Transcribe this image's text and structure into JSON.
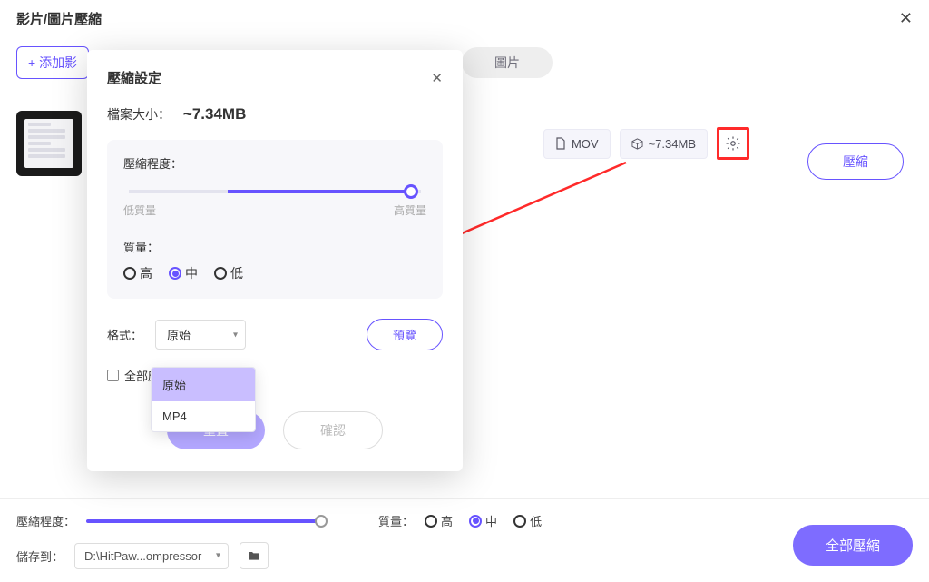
{
  "header": {
    "title": "影片/圖片壓縮"
  },
  "toolbar": {
    "add_label": "+ 添加影",
    "tabs": {
      "image": "圖片"
    }
  },
  "file": {
    "format": "MOV",
    "size_est": "~7.34MB"
  },
  "compress_label": "壓縮",
  "dialog": {
    "title": "壓縮設定",
    "filesize_label": "檔案大小：",
    "filesize_value": "~7.34MB",
    "degree_label": "壓縮程度：",
    "low_q": "低質量",
    "high_q": "高質量",
    "quality_label": "質量：",
    "quality_opts": {
      "high": "高",
      "mid": "中",
      "low": "低"
    },
    "quality_selected": "mid",
    "format_label": "格式：",
    "format_selected": "原始",
    "format_options": [
      "原始",
      "MP4"
    ],
    "preview_label": "預覽",
    "apply_all_label": "全部應",
    "reset_label": "重置",
    "confirm_label": "確認"
  },
  "bottom": {
    "degree_label": "壓縮程度：",
    "quality_label": "質量：",
    "quality_opts": {
      "high": "高",
      "mid": "中",
      "low": "低"
    },
    "quality_selected": "mid",
    "save_label": "儲存到：",
    "save_path": "D:\\HitPaw...ompressor",
    "compress_all": "全部壓縮"
  }
}
